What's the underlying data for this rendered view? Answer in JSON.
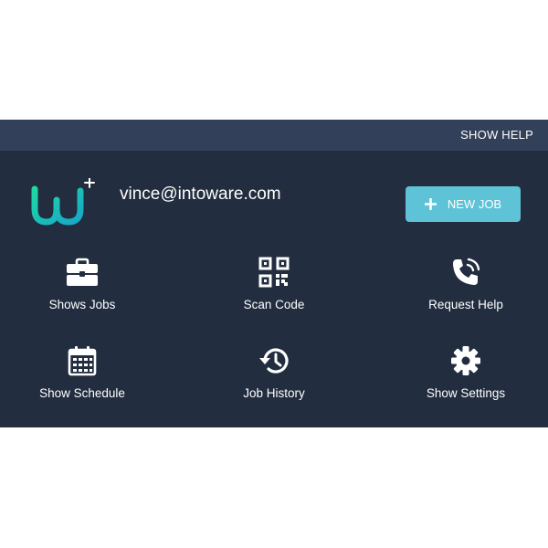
{
  "header": {
    "help_label": "SHOW HELP"
  },
  "user": {
    "email": "vince@intoware.com"
  },
  "actions": {
    "new_job_label": "NEW JOB"
  },
  "tiles": [
    {
      "label": "Shows Jobs",
      "icon": "briefcase-icon"
    },
    {
      "label": "Scan Code",
      "icon": "qr-code-icon"
    },
    {
      "label": "Request Help",
      "icon": "phone-ringing-icon"
    },
    {
      "label": "Show Schedule",
      "icon": "calendar-icon"
    },
    {
      "label": "Job History",
      "icon": "history-icon"
    },
    {
      "label": "Show Settings",
      "icon": "gear-icon"
    }
  ],
  "colors": {
    "panel_bg": "#222d40",
    "topbar_bg": "#334059",
    "accent_button": "#5ec3d6",
    "logo_gradient_start": "#1fd8a2",
    "logo_gradient_end": "#17a7c9"
  }
}
